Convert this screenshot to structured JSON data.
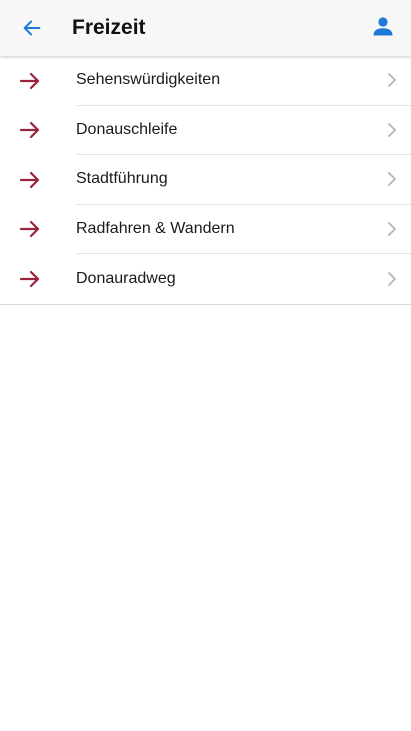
{
  "header": {
    "title": "Freizeit",
    "back_icon": "arrow-left-icon",
    "profile_icon": "person-icon"
  },
  "colors": {
    "accent_blue": "#1e7ad6",
    "arrow_red": "#9c2340",
    "chevron_gray": "#b5b5b5"
  },
  "items": [
    {
      "label": "Sehenswürdigkeiten",
      "icon": "arrow-right-icon"
    },
    {
      "label": "Donauschleife",
      "icon": "arrow-right-icon"
    },
    {
      "label": "Stadtführung",
      "icon": "arrow-right-icon"
    },
    {
      "label": "Radfahren & Wandern",
      "icon": "arrow-right-icon"
    },
    {
      "label": "Donauradweg",
      "icon": "arrow-right-icon"
    }
  ]
}
